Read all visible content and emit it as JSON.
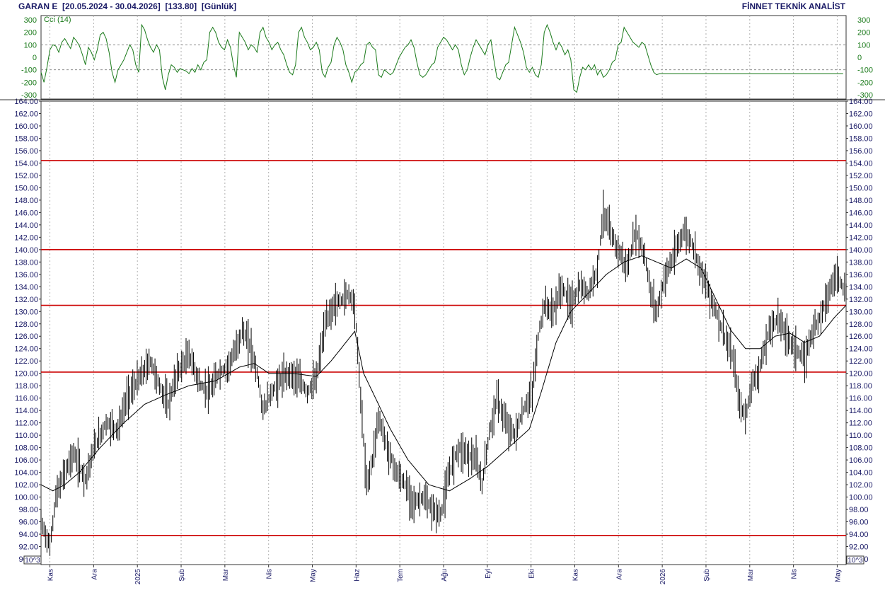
{
  "header": {
    "symbol": "GARAN E",
    "range": "[20.05.2024 - 30.04.2026]",
    "last": "[133.80]",
    "period": "[Günlük]",
    "brand": "FİNNET TEKNİK ANALİST"
  },
  "colors": {
    "price_bars": "#000000",
    "moving_average": "#000000",
    "horizontal_levels": "#cc0000",
    "cci_line": "#1a7a1a",
    "text": "#1a1a66",
    "grid": "#b0b0b0"
  },
  "chart_data": [
    {
      "type": "line",
      "indicator": "CCI",
      "legend": "Cci (14)",
      "ylim": [
        -300,
        300
      ],
      "yticks": [
        300,
        200,
        100,
        0,
        -100,
        -200,
        -300
      ],
      "reference_lines": [
        100,
        -100
      ],
      "x": [
        0,
        2,
        4,
        6,
        8,
        10,
        12,
        14,
        16,
        18,
        20,
        22,
        24,
        26,
        28,
        30,
        32,
        34,
        36,
        38,
        40,
        42,
        44,
        46,
        48,
        50,
        52,
        54,
        56,
        58,
        60,
        62,
        64,
        66,
        68,
        70,
        72,
        74,
        76,
        78,
        80,
        82,
        84,
        86,
        88,
        90,
        92,
        94,
        96,
        98,
        100,
        102,
        104,
        106,
        108,
        110,
        112,
        114,
        116,
        118,
        120,
        122,
        124,
        126,
        128,
        130,
        132,
        134,
        136,
        138,
        140,
        142,
        144,
        146,
        148,
        150,
        152,
        154,
        156,
        158,
        160,
        162,
        164,
        166,
        168,
        170,
        172,
        174,
        176,
        178,
        180,
        182,
        184,
        186,
        188,
        190,
        192,
        194,
        196,
        198,
        200,
        202,
        204,
        206,
        208,
        210,
        212,
        214,
        216,
        218,
        220,
        222,
        224,
        226,
        228,
        230,
        232,
        234,
        236,
        238,
        240,
        242,
        244,
        246,
        248,
        250,
        252,
        254,
        256,
        258,
        260,
        262,
        264,
        266,
        268,
        270,
        272,
        274,
        276,
        278,
        280,
        282,
        284,
        286,
        288,
        290,
        292,
        294,
        296,
        298,
        300,
        302,
        304,
        306,
        308,
        310,
        312,
        314,
        316,
        318,
        320,
        322,
        324,
        326,
        328,
        330,
        332,
        334,
        336,
        338,
        340,
        342,
        344,
        346,
        348,
        350,
        352,
        354,
        356,
        358,
        360,
        362,
        364,
        366,
        368,
        370,
        372,
        374,
        376,
        378,
        380,
        382,
        384,
        386,
        388,
        390,
        392,
        394,
        396,
        398,
        400,
        402,
        404,
        406,
        408,
        410,
        412,
        414,
        416,
        418,
        420,
        422,
        424,
        426,
        428,
        430,
        432,
        434,
        436,
        438,
        440,
        442,
        444,
        446,
        448,
        450,
        452,
        454,
        456,
        458,
        460,
        462,
        464,
        466,
        468,
        470,
        472,
        474,
        476,
        478,
        480,
        482,
        484,
        486,
        488,
        490,
        492,
        494,
        496,
        498,
        500,
        502,
        504,
        506,
        508,
        510,
        512,
        514,
        516,
        518,
        520,
        522,
        524,
        526,
        528,
        530,
        532,
        534,
        536,
        538,
        540,
        542,
        544
      ],
      "values": [
        -120,
        -200,
        -80,
        60,
        100,
        90,
        40,
        120,
        150,
        110,
        70,
        160,
        130,
        90,
        20,
        -60,
        80,
        40,
        -20,
        60,
        180,
        200,
        150,
        40,
        -120,
        -200,
        -100,
        -60,
        -20,
        40,
        100,
        60,
        -60,
        -120,
        260,
        220,
        140,
        80,
        40,
        100,
        60,
        -160,
        -260,
        -140,
        -60,
        -80,
        -120,
        -90,
        -100,
        -110,
        -130,
        -90,
        -120,
        -60,
        -100,
        -40,
        -20,
        200,
        240,
        200,
        120,
        80,
        60,
        140,
        80,
        -60,
        -160,
        200,
        160,
        120,
        60,
        100,
        80,
        40,
        200,
        240,
        160,
        120,
        60,
        100,
        120,
        60,
        20,
        -60,
        -120,
        -140,
        -60,
        200,
        240,
        160,
        120,
        60,
        80,
        120,
        60,
        -120,
        -160,
        -80,
        -40,
        100,
        160,
        120,
        60,
        -60,
        -120,
        -200,
        -120,
        -100,
        -60,
        -40,
        100,
        120,
        80,
        60,
        -140,
        -160,
        -100,
        -120,
        -140,
        -120,
        -60,
        0,
        40,
        80,
        100,
        140,
        80,
        -40,
        -140,
        -160,
        -140,
        -100,
        -60,
        -40,
        80,
        120,
        160,
        140,
        100,
        60,
        100,
        60,
        -60,
        -140,
        -100,
        0,
        80,
        140,
        100,
        60,
        20,
        100,
        140,
        -20,
        -160,
        -180,
        -120,
        -60,
        -40,
        100,
        240,
        180,
        120,
        40,
        -80,
        -120,
        -80,
        -140,
        -160,
        -60,
        200,
        260,
        200,
        120,
        60,
        120,
        80,
        20,
        60,
        -20,
        -260,
        -280,
        -160,
        -80,
        -100,
        -60,
        -100,
        -60,
        -140,
        -100,
        -160,
        -140,
        -100,
        -40,
        -20,
        100,
        120,
        240,
        200,
        160,
        120,
        100,
        80,
        120,
        100,
        20,
        -60,
        -120,
        -140,
        -130,
        -130,
        -130,
        -130,
        -130,
        -130,
        -130,
        -130,
        -130,
        -130,
        -130,
        -130,
        -130,
        -130,
        -130,
        -130,
        -130,
        -130,
        -130,
        -130,
        -130,
        -130,
        -130,
        -130,
        -130,
        -130,
        -130,
        -130,
        -130,
        -130,
        -130,
        -130,
        -130,
        -130,
        -130,
        -130,
        -130,
        -130,
        -130,
        -130,
        -130,
        -130,
        -130,
        -130,
        -130,
        -130,
        -130,
        -130,
        -130,
        -130,
        -130,
        -130,
        -130,
        -130,
        -130,
        -130,
        -130,
        -130,
        -130,
        -130,
        -130,
        -130,
        -130
      ]
    },
    {
      "type": "bar",
      "subtype": "ohlc",
      "ylim": [
        90,
        164
      ],
      "y_scale_note": "10^3",
      "yticks": [
        164,
        162,
        160,
        158,
        156,
        154,
        152,
        150,
        148,
        146,
        144,
        142,
        140,
        138,
        136,
        134,
        132,
        130,
        128,
        126,
        124,
        122,
        120,
        118,
        116,
        114,
        112,
        110,
        108,
        106,
        104,
        102,
        100,
        98,
        96,
        94,
        92,
        90
      ],
      "y_tick_labels": [
        "164.00",
        "162.00",
        "160.00",
        "158.00",
        "156.00",
        "154.00",
        "152.00",
        "150.00",
        "148.00",
        "146.00",
        "144.00",
        "142.00",
        "140.00",
        "138.00",
        "136.00",
        "134.00",
        "132.00",
        "130.00",
        "128.00",
        "126.00",
        "124.00",
        "122.00",
        "120.00",
        "118.00",
        "116.00",
        "114.00",
        "112.00",
        "110.00",
        "108.00",
        "106.00",
        "104.00",
        "102.00",
        "100.00",
        "98.00",
        "96.00",
        "94.00",
        "92.00",
        "90.00"
      ],
      "x_labels": [
        "Kas",
        "Ara",
        "2025",
        "Şub",
        "Mar",
        "Nis",
        "May",
        "Haz",
        "Tem",
        "Ağu",
        "Eyl",
        "Eki",
        "Kas",
        "Ara",
        "2026",
        "Şub",
        "Mar",
        "Nis",
        "May"
      ],
      "horizontal_levels": [
        154.4,
        140.0,
        131.0,
        120.2,
        93.8
      ],
      "anchors": [
        {
          "x": 0,
          "v": 96
        },
        {
          "x": 6,
          "v": 92
        },
        {
          "x": 10,
          "v": 100
        },
        {
          "x": 16,
          "v": 104
        },
        {
          "x": 22,
          "v": 107
        },
        {
          "x": 30,
          "v": 103
        },
        {
          "x": 36,
          "v": 108
        },
        {
          "x": 44,
          "v": 112
        },
        {
          "x": 52,
          "v": 111
        },
        {
          "x": 58,
          "v": 116
        },
        {
          "x": 66,
          "v": 119
        },
        {
          "x": 74,
          "v": 122
        },
        {
          "x": 80,
          "v": 118
        },
        {
          "x": 86,
          "v": 115
        },
        {
          "x": 92,
          "v": 120
        },
        {
          "x": 100,
          "v": 123
        },
        {
          "x": 108,
          "v": 118
        },
        {
          "x": 114,
          "v": 117
        },
        {
          "x": 120,
          "v": 120
        },
        {
          "x": 126,
          "v": 121
        },
        {
          "x": 132,
          "v": 124
        },
        {
          "x": 136,
          "v": 127
        },
        {
          "x": 142,
          "v": 124
        },
        {
          "x": 146,
          "v": 120
        },
        {
          "x": 150,
          "v": 114
        },
        {
          "x": 156,
          "v": 117
        },
        {
          "x": 162,
          "v": 119
        },
        {
          "x": 168,
          "v": 120
        },
        {
          "x": 174,
          "v": 119
        },
        {
          "x": 180,
          "v": 117
        },
        {
          "x": 186,
          "v": 119
        },
        {
          "x": 192,
          "v": 128
        },
        {
          "x": 198,
          "v": 131
        },
        {
          "x": 204,
          "v": 132
        },
        {
          "x": 208,
          "v": 133
        },
        {
          "x": 212,
          "v": 131
        },
        {
          "x": 216,
          "v": 116
        },
        {
          "x": 220,
          "v": 102
        },
        {
          "x": 224,
          "v": 106
        },
        {
          "x": 228,
          "v": 113
        },
        {
          "x": 234,
          "v": 108
        },
        {
          "x": 240,
          "v": 104
        },
        {
          "x": 246,
          "v": 102
        },
        {
          "x": 252,
          "v": 99
        },
        {
          "x": 258,
          "v": 100
        },
        {
          "x": 264,
          "v": 98
        },
        {
          "x": 270,
          "v": 97
        },
        {
          "x": 276,
          "v": 104
        },
        {
          "x": 282,
          "v": 108
        },
        {
          "x": 288,
          "v": 107
        },
        {
          "x": 294,
          "v": 106
        },
        {
          "x": 298,
          "v": 102
        },
        {
          "x": 302,
          "v": 109
        },
        {
          "x": 308,
          "v": 116
        },
        {
          "x": 314,
          "v": 112
        },
        {
          "x": 320,
          "v": 110
        },
        {
          "x": 326,
          "v": 114
        },
        {
          "x": 332,
          "v": 117
        },
        {
          "x": 336,
          "v": 126
        },
        {
          "x": 340,
          "v": 131
        },
        {
          "x": 346,
          "v": 130
        },
        {
          "x": 352,
          "v": 134
        },
        {
          "x": 358,
          "v": 131
        },
        {
          "x": 364,
          "v": 134
        },
        {
          "x": 370,
          "v": 133
        },
        {
          "x": 376,
          "v": 137
        },
        {
          "x": 380,
          "v": 146
        },
        {
          "x": 386,
          "v": 142
        },
        {
          "x": 392,
          "v": 139
        },
        {
          "x": 396,
          "v": 137
        },
        {
          "x": 402,
          "v": 143
        },
        {
          "x": 408,
          "v": 139
        },
        {
          "x": 412,
          "v": 133
        },
        {
          "x": 416,
          "v": 130
        },
        {
          "x": 422,
          "v": 136
        },
        {
          "x": 428,
          "v": 139
        },
        {
          "x": 434,
          "v": 143
        },
        {
          "x": 440,
          "v": 141
        },
        {
          "x": 444,
          "v": 138
        },
        {
          "x": 450,
          "v": 134
        },
        {
          "x": 456,
          "v": 130
        },
        {
          "x": 462,
          "v": 126
        },
        {
          "x": 468,
          "v": 122
        },
        {
          "x": 472,
          "v": 115
        },
        {
          "x": 476,
          "v": 113
        },
        {
          "x": 480,
          "v": 118
        },
        {
          "x": 486,
          "v": 121
        },
        {
          "x": 492,
          "v": 127
        },
        {
          "x": 498,
          "v": 129
        },
        {
          "x": 504,
          "v": 126
        },
        {
          "x": 510,
          "v": 124
        },
        {
          "x": 516,
          "v": 122
        },
        {
          "x": 520,
          "v": 126
        },
        {
          "x": 526,
          "v": 129
        },
        {
          "x": 532,
          "v": 133
        },
        {
          "x": 538,
          "v": 136
        },
        {
          "x": 544,
          "v": 133
        }
      ],
      "moving_average_anchors": [
        {
          "x": 0,
          "v": 102
        },
        {
          "x": 8,
          "v": 101
        },
        {
          "x": 16,
          "v": 102
        },
        {
          "x": 26,
          "v": 104
        },
        {
          "x": 40,
          "v": 108
        },
        {
          "x": 56,
          "v": 112
        },
        {
          "x": 70,
          "v": 115
        },
        {
          "x": 84,
          "v": 116.5
        },
        {
          "x": 100,
          "v": 118
        },
        {
          "x": 118,
          "v": 118.8
        },
        {
          "x": 134,
          "v": 121
        },
        {
          "x": 144,
          "v": 121.6
        },
        {
          "x": 154,
          "v": 120
        },
        {
          "x": 170,
          "v": 120
        },
        {
          "x": 186,
          "v": 119.5
        },
        {
          "x": 196,
          "v": 122
        },
        {
          "x": 206,
          "v": 125
        },
        {
          "x": 212,
          "v": 126.8
        },
        {
          "x": 218,
          "v": 120
        },
        {
          "x": 226,
          "v": 116
        },
        {
          "x": 236,
          "v": 111
        },
        {
          "x": 248,
          "v": 106
        },
        {
          "x": 262,
          "v": 102
        },
        {
          "x": 276,
          "v": 101
        },
        {
          "x": 290,
          "v": 103
        },
        {
          "x": 302,
          "v": 105
        },
        {
          "x": 316,
          "v": 108
        },
        {
          "x": 330,
          "v": 111
        },
        {
          "x": 338,
          "v": 117
        },
        {
          "x": 348,
          "v": 125
        },
        {
          "x": 358,
          "v": 130
        },
        {
          "x": 370,
          "v": 133
        },
        {
          "x": 382,
          "v": 136
        },
        {
          "x": 394,
          "v": 138
        },
        {
          "x": 406,
          "v": 139
        },
        {
          "x": 416,
          "v": 138
        },
        {
          "x": 426,
          "v": 137
        },
        {
          "x": 436,
          "v": 138.5
        },
        {
          "x": 446,
          "v": 137
        },
        {
          "x": 456,
          "v": 132
        },
        {
          "x": 466,
          "v": 127
        },
        {
          "x": 476,
          "v": 124
        },
        {
          "x": 486,
          "v": 124
        },
        {
          "x": 496,
          "v": 126
        },
        {
          "x": 506,
          "v": 126.5
        },
        {
          "x": 516,
          "v": 125
        },
        {
          "x": 526,
          "v": 126
        },
        {
          "x": 536,
          "v": 129
        },
        {
          "x": 544,
          "v": 131
        }
      ]
    }
  ]
}
